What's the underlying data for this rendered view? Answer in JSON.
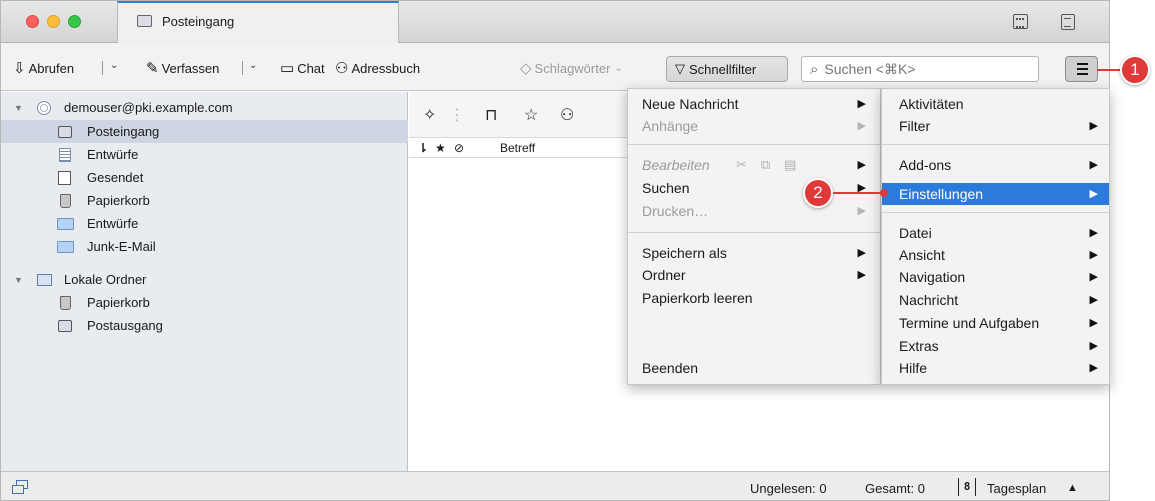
{
  "tab": {
    "title": "Posteingang"
  },
  "toolbar": {
    "get_messages": "Abrufen",
    "compose": "Verfassen",
    "chat": "Chat",
    "address_book": "Adressbuch",
    "tags": "Schlagwörter",
    "quick_filter": "Schnellfilter",
    "search_placeholder": "Suchen <⌘K>"
  },
  "folders": {
    "account": "demouser@pki.example.com",
    "items": [
      {
        "label": "Posteingang",
        "icon": "inbox-icon"
      },
      {
        "label": "Entwürfe",
        "icon": "drafts-icon"
      },
      {
        "label": "Gesendet",
        "icon": "sent-icon"
      },
      {
        "label": "Papierkorb",
        "icon": "trash-icon"
      },
      {
        "label": "Entwürfe",
        "icon": "folder-icon"
      },
      {
        "label": "Junk-E-Mail",
        "icon": "folder-icon"
      }
    ],
    "local_label": "Lokale Ordner",
    "local_items": [
      {
        "label": "Papierkorb",
        "icon": "trash-icon"
      },
      {
        "label": "Postausgang",
        "icon": "outbox-icon"
      }
    ]
  },
  "message_list": {
    "subject_header": "Betreff"
  },
  "app_menu": {
    "left": {
      "new_message": "Neue Nachricht",
      "attachments": "Anhänge",
      "edit": "Bearbeiten",
      "search": "Suchen",
      "print": "Drucken…",
      "save_as": "Speichern als",
      "folder": "Ordner",
      "empty_trash": "Papierkorb leeren",
      "quit": "Beenden"
    },
    "right": {
      "activities": "Aktivitäten",
      "filter": "Filter",
      "addons": "Add-ons",
      "settings": "Einstellungen",
      "file": "Datei",
      "view": "Ansicht",
      "navigation": "Navigation",
      "message": "Nachricht",
      "events_tasks": "Termine und Aufgaben",
      "extras": "Extras",
      "help": "Hilfe"
    }
  },
  "status": {
    "unread": "Ungelesen: 0",
    "total": "Gesamt: 0",
    "day_plan": "Tagesplan",
    "day_number": "8"
  },
  "callouts": {
    "one": "1",
    "two": "2"
  },
  "colors": {
    "accent": "#2b7bdb",
    "callout": "#e0393a",
    "selection": "#cdd6e2"
  }
}
